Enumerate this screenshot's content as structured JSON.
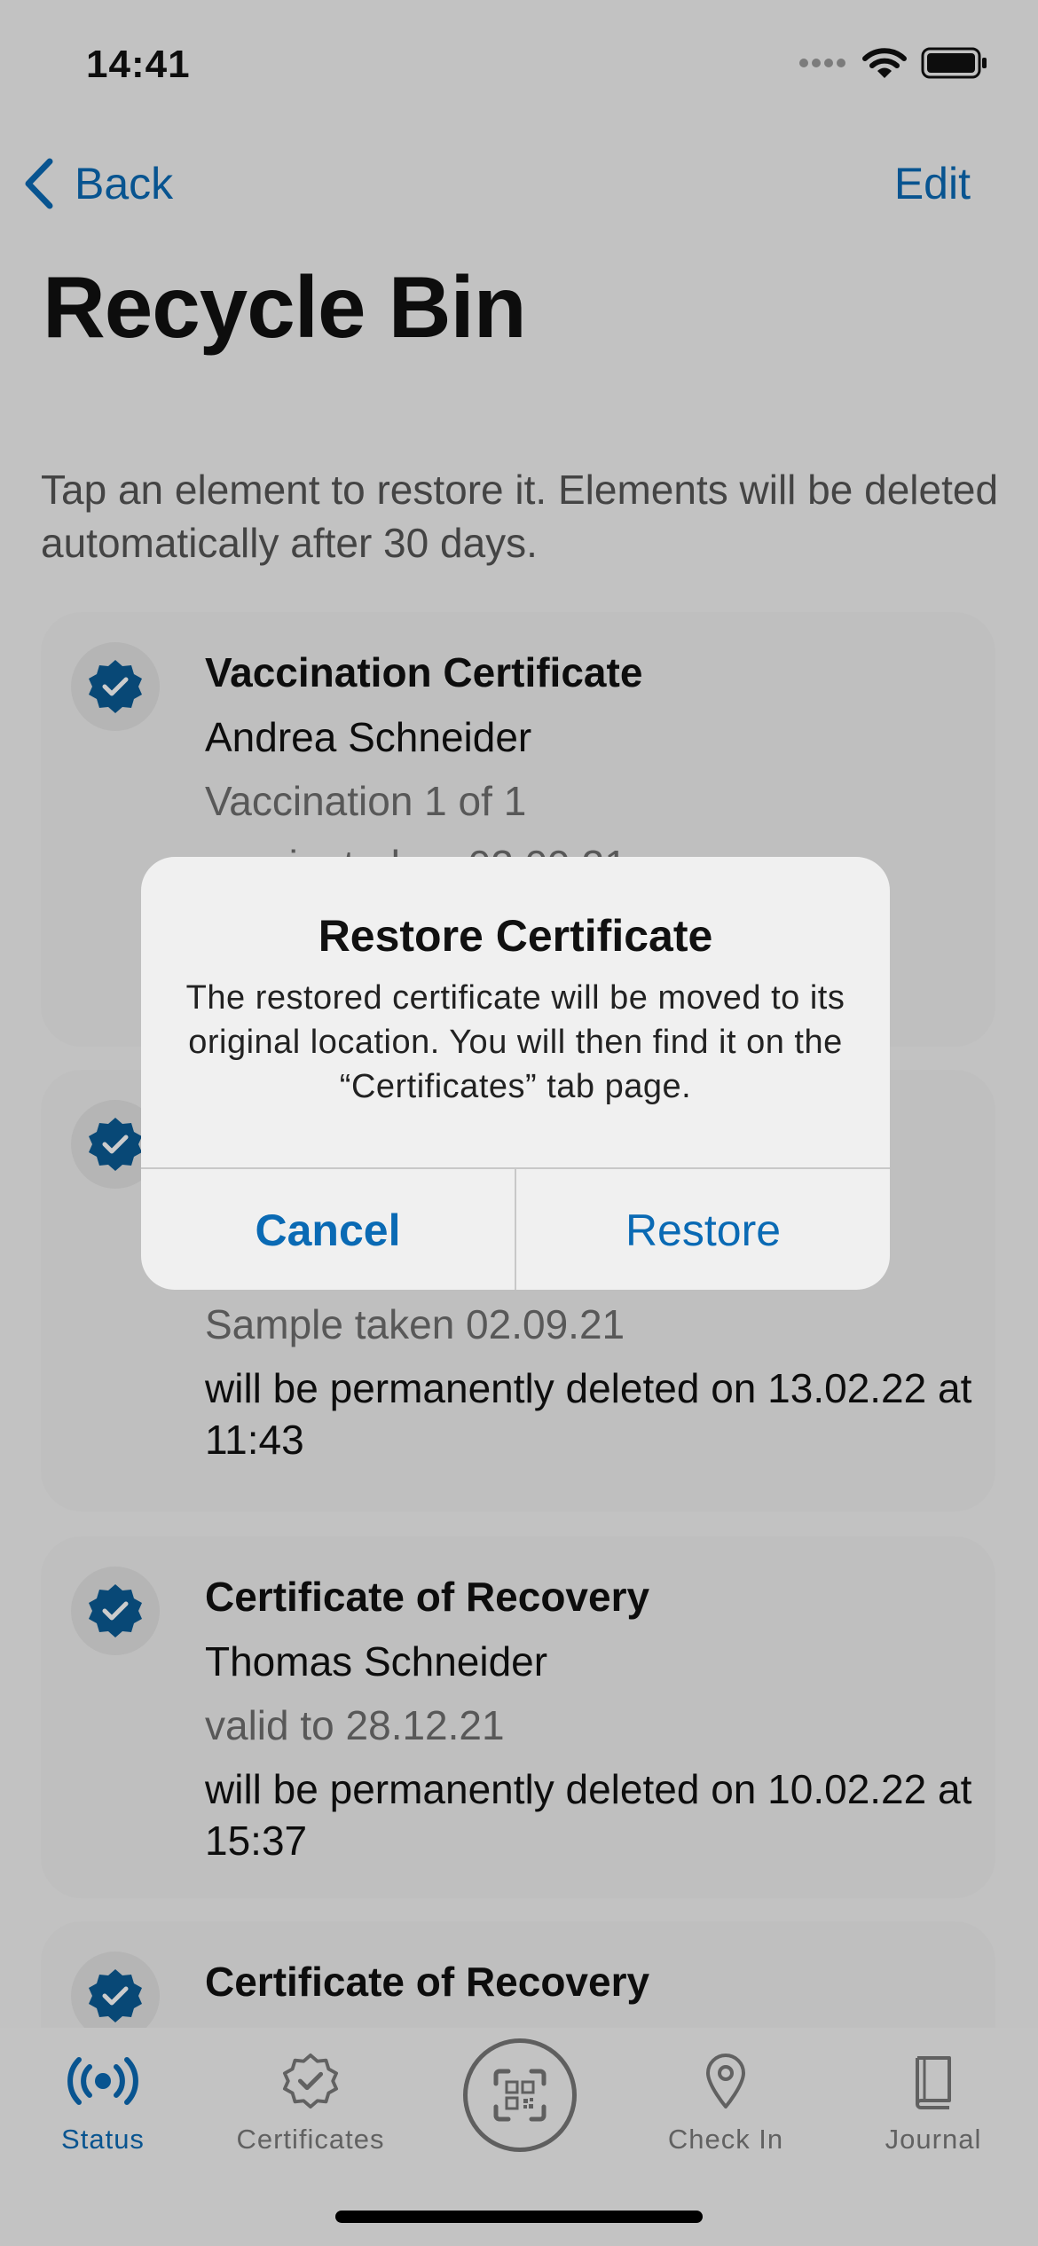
{
  "status_bar": {
    "time": "14:41"
  },
  "nav": {
    "back_label": "Back",
    "edit_label": "Edit"
  },
  "page": {
    "title": "Recycle Bin",
    "intro": "Tap an element to restore it. Elements will be deleted automatically after 30 days."
  },
  "cards": [
    {
      "title": "Vaccination Certificate",
      "name": "Andrea Schneider",
      "sub": "Vaccination 1 of 1",
      "sub2": "vaccinated on 02.09.21"
    },
    {
      "sub": "Sample taken 02.09.21",
      "deletion": "will be permanently deleted on 13.02.22 at 11:43"
    },
    {
      "title": "Certificate of Recovery",
      "name": "Thomas Schneider",
      "sub": "valid to 28.12.21",
      "deletion": "will be permanently deleted on 10.02.22 at 15:37"
    },
    {
      "title": "Certificate of Recovery"
    }
  ],
  "dialog": {
    "title": "Restore Certificate",
    "message": "The restored certificate will be moved to its original location. You will then find it on the “Certificates” tab page.",
    "cancel_label": "Cancel",
    "restore_label": "Restore"
  },
  "tabbar": {
    "items": [
      {
        "label": "Status",
        "icon": "status-icon",
        "active": true
      },
      {
        "label": "Certificates",
        "icon": "certificate-icon"
      },
      {
        "label": "",
        "icon": "qr-scan-icon"
      },
      {
        "label": "Check In",
        "icon": "location-pin-icon"
      },
      {
        "label": "Journal",
        "icon": "book-icon"
      }
    ]
  },
  "colors": {
    "accent": "#0A6AB4",
    "badge": "#0B5A94"
  }
}
